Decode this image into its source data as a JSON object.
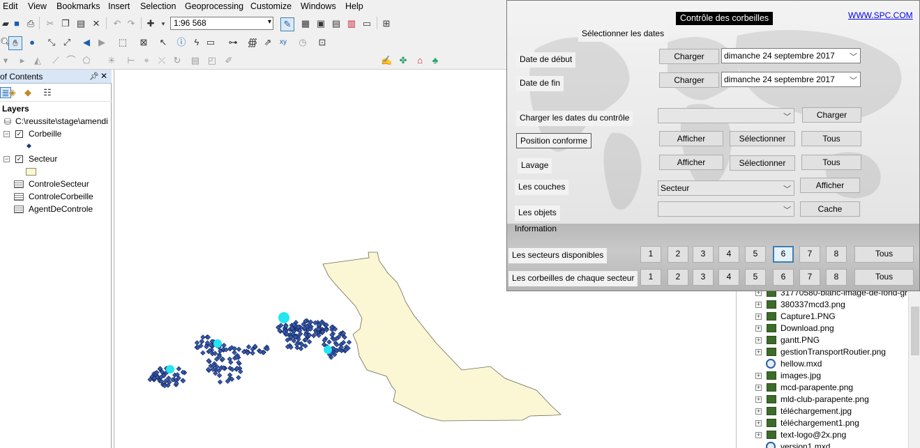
{
  "menu": [
    "Edit",
    "View",
    "Bookmarks",
    "Insert",
    "Selection",
    "Geoprocessing",
    "Customize",
    "Windows",
    "Help"
  ],
  "toolbar": {
    "scale": "1:96 568"
  },
  "toc": {
    "title": "of Contents",
    "layers_heading": "Layers",
    "path": "C:\\reussite\\stage\\amendi",
    "layers": [
      {
        "name": "Corbeille",
        "checked": true
      },
      {
        "name": "Secteur",
        "checked": true
      }
    ],
    "tables": [
      "ControleSecteur",
      "ControleCorbeille",
      "AgentDeControle"
    ]
  },
  "catalog": {
    "items": [
      {
        "name": "31770580-blanc-image-de-fond-gr",
        "type": "image"
      },
      {
        "name": "380337mcd3.png",
        "type": "image"
      },
      {
        "name": "Capture1.PNG",
        "type": "image"
      },
      {
        "name": "Download.png",
        "type": "image"
      },
      {
        "name": "gantt.PNG",
        "type": "image"
      },
      {
        "name": "gestionTransportRoutier.png",
        "type": "image"
      },
      {
        "name": "hellow.mxd",
        "type": "mxd"
      },
      {
        "name": "images.jpg",
        "type": "image"
      },
      {
        "name": "mcd-parapente.png",
        "type": "image"
      },
      {
        "name": "mld-club-parapente.png",
        "type": "image"
      },
      {
        "name": "téléchargement.jpg",
        "type": "image"
      },
      {
        "name": "téléchargement1.png",
        "type": "image"
      },
      {
        "name": "text-logo@2x.png",
        "type": "image"
      },
      {
        "name": "version1.mxd",
        "type": "mxd"
      }
    ]
  },
  "dialog": {
    "title": "Contrôle des corbeilles",
    "link": "WWW.SPC.COM",
    "select_dates": "Sélectionner les dates",
    "start_label": "Date de début",
    "end_label": "Date de fin",
    "load": "Charger",
    "start_value": "dimanche 24 septembre 2017",
    "end_value": "dimanche 24 septembre 2017",
    "load_dates_label": "Charger les dates du contrôle",
    "position_label": "Position conforme",
    "lavage_label": "Lavage",
    "couches_label": "Les couches",
    "couches_value": "Secteur",
    "objets_label": "Les objets",
    "show": "Afficher",
    "select": "Sélectionner",
    "all": "Tous",
    "cache": "Cache",
    "information": "Information",
    "sectors_label": "Les secteurs disponibles",
    "bins_label": "Les corbeilles de chaque secteur",
    "sector_numbers": [
      "1",
      "2",
      "3",
      "4",
      "5",
      "6",
      "7",
      "8"
    ],
    "selected_sector": "6"
  },
  "colors": {
    "polygon_fill": "#fbf6d4",
    "point_fill": "#3559b0",
    "highlight_point": "#22e6f0",
    "link": "#0000ee"
  }
}
